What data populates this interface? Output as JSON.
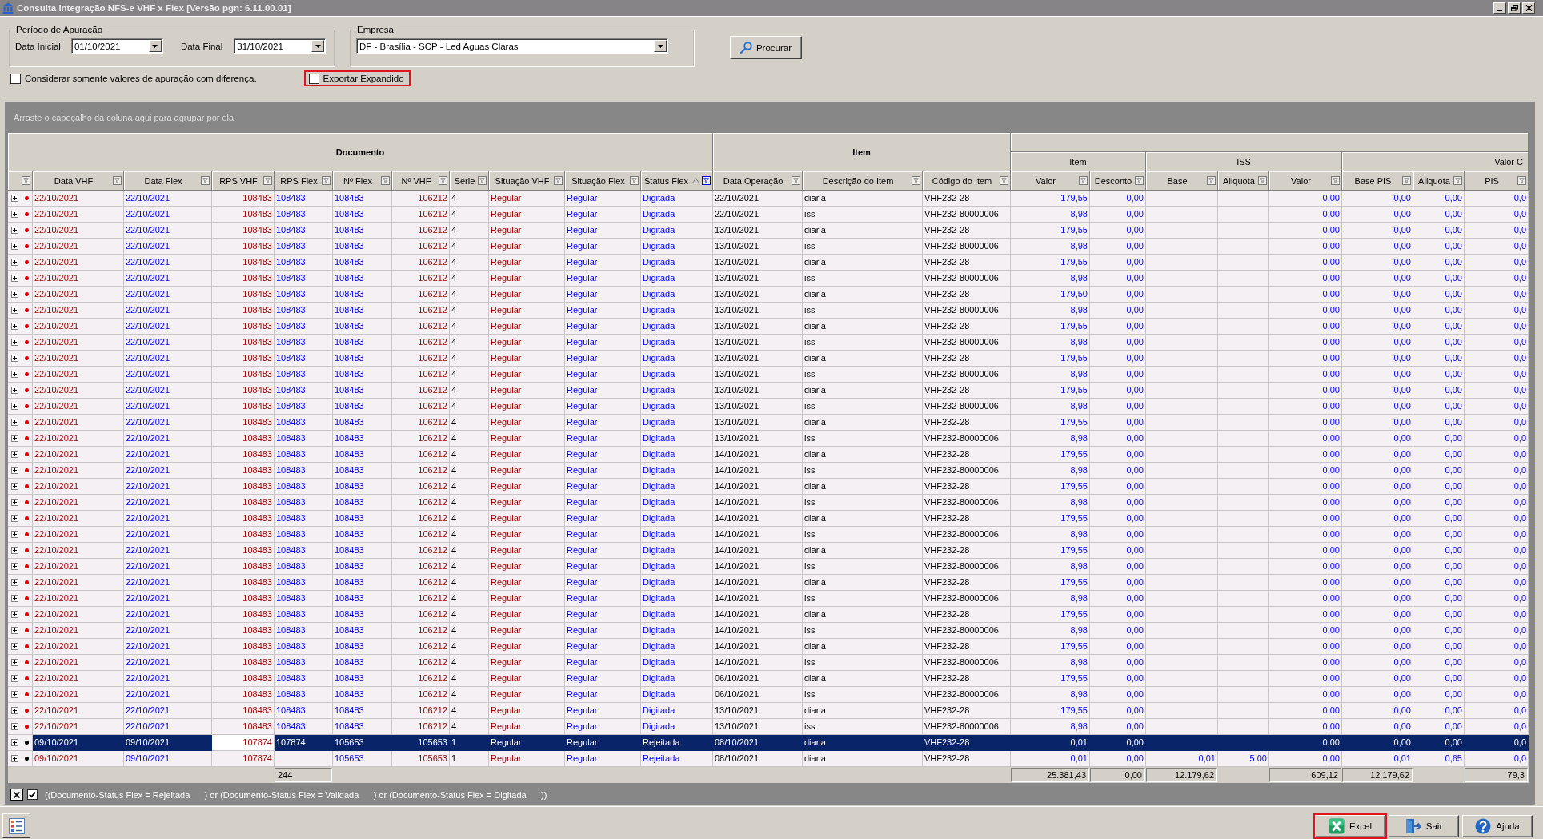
{
  "window": {
    "title": "Consulta Integração NFS-e VHF x Flex [Versão pgn: 6.11.00.01]"
  },
  "period": {
    "title": "Período de Apuração",
    "fields": [
      {
        "label": "Data Inicial",
        "value": "01/10/2021"
      },
      {
        "label": "Data Final",
        "value": "31/10/2021"
      }
    ]
  },
  "company": {
    "title": "Empresa",
    "value": "DF - Brasília - SCP - Led Aguas Claras"
  },
  "search_button": {
    "label": "Procurar"
  },
  "options": [
    {
      "label": "Considerar somente valores de apuração com diferença.",
      "checked": false,
      "highlighted": false
    },
    {
      "label": "Exportar Expandido",
      "checked": false,
      "highlighted": true
    }
  ],
  "grid": {
    "group_hint": "Arraste o cabeçalho da coluna aqui para agrupar por ela",
    "indicator_column": {
      "filtered": false
    },
    "bands": [
      {
        "label": "Documento",
        "columns": [
          {
            "label": "Data VHF",
            "filtered": false,
            "sorted": false,
            "focused": false
          },
          {
            "label": "Data Flex",
            "filtered": false,
            "sorted": false,
            "focused": false
          },
          {
            "label": "RPS VHF",
            "filtered": false,
            "sorted": false,
            "focused": true
          },
          {
            "label": "RPS Flex",
            "filtered": false,
            "sorted": false,
            "focused": false,
            "total": "244"
          },
          {
            "label": "Nº Flex",
            "filtered": false,
            "sorted": false,
            "focused": false
          },
          {
            "label": "Nº VHF",
            "filtered": false,
            "sorted": false,
            "focused": false
          },
          {
            "label": "Série",
            "filtered": false,
            "sorted": false,
            "focused": false
          },
          {
            "label": "Situação VHF",
            "filtered": false,
            "sorted": false,
            "focused": false
          },
          {
            "label": "Situação Flex",
            "filtered": false,
            "sorted": false,
            "focused": false
          },
          {
            "label": "Status Flex",
            "filtered": true,
            "sorted": true,
            "focused": false
          }
        ]
      },
      {
        "label": "Item",
        "columns": [
          {
            "label": "Data Operação",
            "filtered": false,
            "sorted": false,
            "focused": false
          },
          {
            "label": "Descrição do Item",
            "filtered": false,
            "sorted": false,
            "focused": false
          },
          {
            "label": "Código do Item",
            "filtered": false,
            "sorted": false,
            "focused": false
          }
        ]
      },
      {
        "children": [
          {
            "label": "Item",
            "columns": [
              {
                "label": "Valor",
                "filtered": false,
                "sorted": false,
                "focused": false,
                "total": "25.381,43"
              },
              {
                "label": "Desconto",
                "filtered": false,
                "sorted": false,
                "focused": false,
                "total": "0,00"
              }
            ]
          },
          {
            "label": "ISS",
            "columns": [
              {
                "label": "Base",
                "filtered": false,
                "sorted": false,
                "focused": false,
                "total": "12.179,62"
              },
              {
                "label": "Aliquota",
                "filtered": false,
                "sorted": false,
                "focused": false
              },
              {
                "label": "Valor",
                "filtered": false,
                "sorted": false,
                "focused": false,
                "total": "609,12"
              }
            ]
          },
          {
            "label": "Valor C",
            "columns": [
              {
                "label": "Base PIS",
                "filtered": false,
                "sorted": false,
                "focused": false,
                "total": "12.179,62"
              },
              {
                "label": "Aliquota",
                "filtered": false,
                "sorted": false,
                "focused": false
              },
              {
                "label": "PIS",
                "filtered": false,
                "sorted": false,
                "focused": false,
                "total": "79,3"
              }
            ]
          }
        ]
      }
    ],
    "rows": [
      {
        "selected": false,
        "expanded": false,
        "color": "#e00000",
        "cells": [
          "22/10/2021",
          "22/10/2021",
          "108483",
          "108483",
          "108483",
          "106212",
          "4",
          "Regular",
          "Regular",
          "Digitada",
          "22/10/2021",
          "diaria",
          "VHF232-28",
          "179,55",
          "0,00",
          null,
          null,
          "0,00",
          "0,00",
          "0,00",
          "0,0"
        ]
      },
      {
        "selected": false,
        "expanded": false,
        "color": "#e00000",
        "cells": [
          "22/10/2021",
          "22/10/2021",
          "108483",
          "108483",
          "108483",
          "106212",
          "4",
          "Regular",
          "Regular",
          "Digitada",
          "22/10/2021",
          "iss",
          "VHF232-80000006",
          "8,98",
          "0,00",
          null,
          null,
          "0,00",
          "0,00",
          "0,00",
          "0,0"
        ]
      },
      {
        "selected": false,
        "expanded": false,
        "color": "#e00000",
        "cells": [
          "22/10/2021",
          "22/10/2021",
          "108483",
          "108483",
          "108483",
          "106212",
          "4",
          "Regular",
          "Regular",
          "Digitada",
          "13/10/2021",
          "diaria",
          "VHF232-28",
          "179,55",
          "0,00",
          null,
          null,
          "0,00",
          "0,00",
          "0,00",
          "0,0"
        ]
      },
      {
        "selected": false,
        "expanded": false,
        "color": "#e00000",
        "cells": [
          "22/10/2021",
          "22/10/2021",
          "108483",
          "108483",
          "108483",
          "106212",
          "4",
          "Regular",
          "Regular",
          "Digitada",
          "13/10/2021",
          "iss",
          "VHF232-80000006",
          "8,98",
          "0,00",
          null,
          null,
          "0,00",
          "0,00",
          "0,00",
          "0,0"
        ]
      },
      {
        "selected": false,
        "expanded": false,
        "color": "#e00000",
        "cells": [
          "22/10/2021",
          "22/10/2021",
          "108483",
          "108483",
          "108483",
          "106212",
          "4",
          "Regular",
          "Regular",
          "Digitada",
          "13/10/2021",
          "diaria",
          "VHF232-28",
          "179,55",
          "0,00",
          null,
          null,
          "0,00",
          "0,00",
          "0,00",
          "0,0"
        ]
      },
      {
        "selected": false,
        "expanded": false,
        "color": "#e00000",
        "cells": [
          "22/10/2021",
          "22/10/2021",
          "108483",
          "108483",
          "108483",
          "106212",
          "4",
          "Regular",
          "Regular",
          "Digitada",
          "13/10/2021",
          "iss",
          "VHF232-80000006",
          "8,98",
          "0,00",
          null,
          null,
          "0,00",
          "0,00",
          "0,00",
          "0,0"
        ]
      },
      {
        "selected": false,
        "expanded": false,
        "color": "#e00000",
        "cells": [
          "22/10/2021",
          "22/10/2021",
          "108483",
          "108483",
          "108483",
          "106212",
          "4",
          "Regular",
          "Regular",
          "Digitada",
          "13/10/2021",
          "diaria",
          "VHF232-28",
          "179,50",
          "0,00",
          null,
          null,
          "0,00",
          "0,00",
          "0,00",
          "0,0"
        ]
      },
      {
        "selected": false,
        "expanded": false,
        "color": "#e00000",
        "cells": [
          "22/10/2021",
          "22/10/2021",
          "108483",
          "108483",
          "108483",
          "106212",
          "4",
          "Regular",
          "Regular",
          "Digitada",
          "13/10/2021",
          "iss",
          "VHF232-80000006",
          "8,98",
          "0,00",
          null,
          null,
          "0,00",
          "0,00",
          "0,00",
          "0,0"
        ]
      },
      {
        "selected": false,
        "expanded": false,
        "color": "#e00000",
        "cells": [
          "22/10/2021",
          "22/10/2021",
          "108483",
          "108483",
          "108483",
          "106212",
          "4",
          "Regular",
          "Regular",
          "Digitada",
          "13/10/2021",
          "diaria",
          "VHF232-28",
          "179,55",
          "0,00",
          null,
          null,
          "0,00",
          "0,00",
          "0,00",
          "0,0"
        ]
      },
      {
        "selected": false,
        "expanded": false,
        "color": "#e00000",
        "cells": [
          "22/10/2021",
          "22/10/2021",
          "108483",
          "108483",
          "108483",
          "106212",
          "4",
          "Regular",
          "Regular",
          "Digitada",
          "13/10/2021",
          "iss",
          "VHF232-80000006",
          "8,98",
          "0,00",
          null,
          null,
          "0,00",
          "0,00",
          "0,00",
          "0,0"
        ]
      },
      {
        "selected": false,
        "expanded": false,
        "color": "#e00000",
        "cells": [
          "22/10/2021",
          "22/10/2021",
          "108483",
          "108483",
          "108483",
          "106212",
          "4",
          "Regular",
          "Regular",
          "Digitada",
          "13/10/2021",
          "diaria",
          "VHF232-28",
          "179,55",
          "0,00",
          null,
          null,
          "0,00",
          "0,00",
          "0,00",
          "0,0"
        ]
      },
      {
        "selected": false,
        "expanded": false,
        "color": "#e00000",
        "cells": [
          "22/10/2021",
          "22/10/2021",
          "108483",
          "108483",
          "108483",
          "106212",
          "4",
          "Regular",
          "Regular",
          "Digitada",
          "13/10/2021",
          "iss",
          "VHF232-80000006",
          "8,98",
          "0,00",
          null,
          null,
          "0,00",
          "0,00",
          "0,00",
          "0,0"
        ]
      },
      {
        "selected": false,
        "expanded": false,
        "color": "#e00000",
        "cells": [
          "22/10/2021",
          "22/10/2021",
          "108483",
          "108483",
          "108483",
          "106212",
          "4",
          "Regular",
          "Regular",
          "Digitada",
          "13/10/2021",
          "diaria",
          "VHF232-28",
          "179,55",
          "0,00",
          null,
          null,
          "0,00",
          "0,00",
          "0,00",
          "0,0"
        ]
      },
      {
        "selected": false,
        "expanded": false,
        "color": "#e00000",
        "cells": [
          "22/10/2021",
          "22/10/2021",
          "108483",
          "108483",
          "108483",
          "106212",
          "4",
          "Regular",
          "Regular",
          "Digitada",
          "13/10/2021",
          "iss",
          "VHF232-80000006",
          "8,98",
          "0,00",
          null,
          null,
          "0,00",
          "0,00",
          "0,00",
          "0,0"
        ]
      },
      {
        "selected": false,
        "expanded": false,
        "color": "#e00000",
        "cells": [
          "22/10/2021",
          "22/10/2021",
          "108483",
          "108483",
          "108483",
          "106212",
          "4",
          "Regular",
          "Regular",
          "Digitada",
          "13/10/2021",
          "diaria",
          "VHF232-28",
          "179,55",
          "0,00",
          null,
          null,
          "0,00",
          "0,00",
          "0,00",
          "0,0"
        ]
      },
      {
        "selected": false,
        "expanded": false,
        "color": "#e00000",
        "cells": [
          "22/10/2021",
          "22/10/2021",
          "108483",
          "108483",
          "108483",
          "106212",
          "4",
          "Regular",
          "Regular",
          "Digitada",
          "13/10/2021",
          "iss",
          "VHF232-80000006",
          "8,98",
          "0,00",
          null,
          null,
          "0,00",
          "0,00",
          "0,00",
          "0,0"
        ]
      },
      {
        "selected": false,
        "expanded": false,
        "color": "#e00000",
        "cells": [
          "22/10/2021",
          "22/10/2021",
          "108483",
          "108483",
          "108483",
          "106212",
          "4",
          "Regular",
          "Regular",
          "Digitada",
          "14/10/2021",
          "diaria",
          "VHF232-28",
          "179,55",
          "0,00",
          null,
          null,
          "0,00",
          "0,00",
          "0,00",
          "0,0"
        ]
      },
      {
        "selected": false,
        "expanded": false,
        "color": "#e00000",
        "cells": [
          "22/10/2021",
          "22/10/2021",
          "108483",
          "108483",
          "108483",
          "106212",
          "4",
          "Regular",
          "Regular",
          "Digitada",
          "14/10/2021",
          "iss",
          "VHF232-80000006",
          "8,98",
          "0,00",
          null,
          null,
          "0,00",
          "0,00",
          "0,00",
          "0,0"
        ]
      },
      {
        "selected": false,
        "expanded": false,
        "color": "#e00000",
        "cells": [
          "22/10/2021",
          "22/10/2021",
          "108483",
          "108483",
          "108483",
          "106212",
          "4",
          "Regular",
          "Regular",
          "Digitada",
          "14/10/2021",
          "diaria",
          "VHF232-28",
          "179,55",
          "0,00",
          null,
          null,
          "0,00",
          "0,00",
          "0,00",
          "0,0"
        ]
      },
      {
        "selected": false,
        "expanded": false,
        "color": "#e00000",
        "cells": [
          "22/10/2021",
          "22/10/2021",
          "108483",
          "108483",
          "108483",
          "106212",
          "4",
          "Regular",
          "Regular",
          "Digitada",
          "14/10/2021",
          "iss",
          "VHF232-80000006",
          "8,98",
          "0,00",
          null,
          null,
          "0,00",
          "0,00",
          "0,00",
          "0,0"
        ]
      },
      {
        "selected": false,
        "expanded": false,
        "color": "#e00000",
        "cells": [
          "22/10/2021",
          "22/10/2021",
          "108483",
          "108483",
          "108483",
          "106212",
          "4",
          "Regular",
          "Regular",
          "Digitada",
          "14/10/2021",
          "diaria",
          "VHF232-28",
          "179,55",
          "0,00",
          null,
          null,
          "0,00",
          "0,00",
          "0,00",
          "0,0"
        ]
      },
      {
        "selected": false,
        "expanded": false,
        "color": "#e00000",
        "cells": [
          "22/10/2021",
          "22/10/2021",
          "108483",
          "108483",
          "108483",
          "106212",
          "4",
          "Regular",
          "Regular",
          "Digitada",
          "14/10/2021",
          "iss",
          "VHF232-80000006",
          "8,98",
          "0,00",
          null,
          null,
          "0,00",
          "0,00",
          "0,00",
          "0,0"
        ]
      },
      {
        "selected": false,
        "expanded": false,
        "color": "#e00000",
        "cells": [
          "22/10/2021",
          "22/10/2021",
          "108483",
          "108483",
          "108483",
          "106212",
          "4",
          "Regular",
          "Regular",
          "Digitada",
          "14/10/2021",
          "diaria",
          "VHF232-28",
          "179,55",
          "0,00",
          null,
          null,
          "0,00",
          "0,00",
          "0,00",
          "0,0"
        ]
      },
      {
        "selected": false,
        "expanded": false,
        "color": "#e00000",
        "cells": [
          "22/10/2021",
          "22/10/2021",
          "108483",
          "108483",
          "108483",
          "106212",
          "4",
          "Regular",
          "Regular",
          "Digitada",
          "14/10/2021",
          "iss",
          "VHF232-80000006",
          "8,98",
          "0,00",
          null,
          null,
          "0,00",
          "0,00",
          "0,00",
          "0,0"
        ]
      },
      {
        "selected": false,
        "expanded": false,
        "color": "#e00000",
        "cells": [
          "22/10/2021",
          "22/10/2021",
          "108483",
          "108483",
          "108483",
          "106212",
          "4",
          "Regular",
          "Regular",
          "Digitada",
          "14/10/2021",
          "diaria",
          "VHF232-28",
          "179,55",
          "0,00",
          null,
          null,
          "0,00",
          "0,00",
          "0,00",
          "0,0"
        ]
      },
      {
        "selected": false,
        "expanded": false,
        "color": "#e00000",
        "cells": [
          "22/10/2021",
          "22/10/2021",
          "108483",
          "108483",
          "108483",
          "106212",
          "4",
          "Regular",
          "Regular",
          "Digitada",
          "14/10/2021",
          "iss",
          "VHF232-80000006",
          "8,98",
          "0,00",
          null,
          null,
          "0,00",
          "0,00",
          "0,00",
          "0,0"
        ]
      },
      {
        "selected": false,
        "expanded": false,
        "color": "#e00000",
        "cells": [
          "22/10/2021",
          "22/10/2021",
          "108483",
          "108483",
          "108483",
          "106212",
          "4",
          "Regular",
          "Regular",
          "Digitada",
          "14/10/2021",
          "diaria",
          "VHF232-28",
          "179,55",
          "0,00",
          null,
          null,
          "0,00",
          "0,00",
          "0,00",
          "0,0"
        ]
      },
      {
        "selected": false,
        "expanded": false,
        "color": "#e00000",
        "cells": [
          "22/10/2021",
          "22/10/2021",
          "108483",
          "108483",
          "108483",
          "106212",
          "4",
          "Regular",
          "Regular",
          "Digitada",
          "14/10/2021",
          "iss",
          "VHF232-80000006",
          "8,98",
          "0,00",
          null,
          null,
          "0,00",
          "0,00",
          "0,00",
          "0,0"
        ]
      },
      {
        "selected": false,
        "expanded": false,
        "color": "#e00000",
        "cells": [
          "22/10/2021",
          "22/10/2021",
          "108483",
          "108483",
          "108483",
          "106212",
          "4",
          "Regular",
          "Regular",
          "Digitada",
          "14/10/2021",
          "diaria",
          "VHF232-28",
          "179,55",
          "0,00",
          null,
          null,
          "0,00",
          "0,00",
          "0,00",
          "0,0"
        ]
      },
      {
        "selected": false,
        "expanded": false,
        "color": "#e00000",
        "cells": [
          "22/10/2021",
          "22/10/2021",
          "108483",
          "108483",
          "108483",
          "106212",
          "4",
          "Regular",
          "Regular",
          "Digitada",
          "14/10/2021",
          "iss",
          "VHF232-80000006",
          "8,98",
          "0,00",
          null,
          null,
          "0,00",
          "0,00",
          "0,00",
          "0,0"
        ]
      },
      {
        "selected": false,
        "expanded": false,
        "color": "#e00000",
        "cells": [
          "22/10/2021",
          "22/10/2021",
          "108483",
          "108483",
          "108483",
          "106212",
          "4",
          "Regular",
          "Regular",
          "Digitada",
          "06/10/2021",
          "diaria",
          "VHF232-28",
          "179,55",
          "0,00",
          null,
          null,
          "0,00",
          "0,00",
          "0,00",
          "0,0"
        ]
      },
      {
        "selected": false,
        "expanded": false,
        "color": "#e00000",
        "cells": [
          "22/10/2021",
          "22/10/2021",
          "108483",
          "108483",
          "108483",
          "106212",
          "4",
          "Regular",
          "Regular",
          "Digitada",
          "06/10/2021",
          "iss",
          "VHF232-80000006",
          "8,98",
          "0,00",
          null,
          null,
          "0,00",
          "0,00",
          "0,00",
          "0,0"
        ]
      },
      {
        "selected": false,
        "expanded": false,
        "color": "#e00000",
        "cells": [
          "22/10/2021",
          "22/10/2021",
          "108483",
          "108483",
          "108483",
          "106212",
          "4",
          "Regular",
          "Regular",
          "Digitada",
          "13/10/2021",
          "diaria",
          "VHF232-28",
          "179,55",
          "0,00",
          null,
          null,
          "0,00",
          "0,00",
          "0,00",
          "0,0"
        ]
      },
      {
        "selected": false,
        "expanded": false,
        "color": "#e00000",
        "cells": [
          "22/10/2021",
          "22/10/2021",
          "108483",
          "108483",
          "108483",
          "106212",
          "4",
          "Regular",
          "Regular",
          "Digitada",
          "13/10/2021",
          "iss",
          "VHF232-80000006",
          "8,98",
          "0,00",
          null,
          null,
          "0,00",
          "0,00",
          "0,00",
          "0,0"
        ]
      },
      {
        "selected": true,
        "expanded": false,
        "color": "#000000",
        "cells": [
          "09/10/2021",
          "09/10/2021",
          "107874",
          "107874",
          "105653",
          "105653",
          "1",
          "Regular",
          "Regular",
          "Rejeitada",
          "08/10/2021",
          "diaria",
          "VHF232-28",
          "0,01",
          "0,00",
          null,
          null,
          "0,00",
          "0,00",
          "0,00",
          "0,0"
        ]
      },
      {
        "selected": false,
        "expanded": false,
        "color": "#000000",
        "cells": [
          "09/10/2021",
          "09/10/2021",
          "107874",
          null,
          "105653",
          "105653",
          "1",
          "Regular",
          "Regular",
          "Rejeitada",
          "08/10/2021",
          "diaria",
          "VHF232-28",
          "0,01",
          "0,00",
          "0,01",
          "5,00",
          "0,00",
          "0,01",
          "0,65",
          "0,0"
        ]
      }
    ]
  },
  "filter_bar": {
    "active": true,
    "expression": "((Documento-Status Flex = Rejeitada      ) or (Documento-Status Flex = Validada      ) or (Documento-Status Flex = Digitada      ))"
  },
  "buttons": [
    {
      "label": "Excel",
      "kind": "excel",
      "highlighted": true
    },
    {
      "label": "Sair",
      "kind": "exit",
      "highlighted": false
    },
    {
      "label": "Ajuda",
      "kind": "help",
      "highlighted": false
    }
  ]
}
